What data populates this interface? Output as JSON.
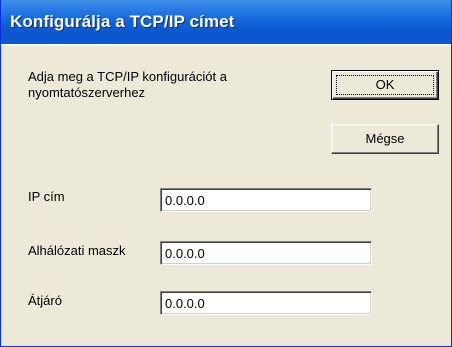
{
  "window": {
    "title": "Konfigurálja a TCP/IP címet"
  },
  "dialog": {
    "instructions_line1": "Adja meg a TCP/IP konfigurációt a",
    "instructions_line2": "nyomtatószerverhez"
  },
  "buttons": {
    "ok_label": "OK",
    "cancel_label": "Mégse"
  },
  "fields": [
    {
      "label": "IP cím",
      "value": "0.0.0.0"
    },
    {
      "label": "Alhálózati maszk",
      "value": "0.0.0.0"
    },
    {
      "label": "Átjáró",
      "value": "0.0.0.0"
    }
  ],
  "colors": {
    "titlebar": "#0a54cc",
    "dialog_background": "#ece9d8",
    "title_text": "#ffffff"
  }
}
